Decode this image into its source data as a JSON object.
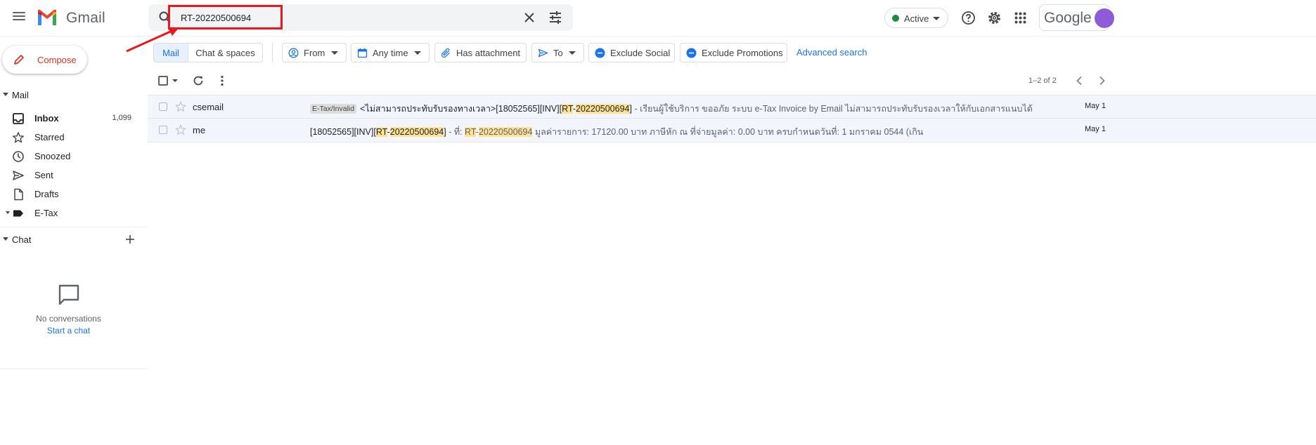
{
  "app": {
    "name": "Gmail"
  },
  "search": {
    "query": "RT-20220500694"
  },
  "status": {
    "label": "Active"
  },
  "account": {
    "brand": "Google"
  },
  "compose": {
    "label": "Compose"
  },
  "nav": {
    "mail_section": "Mail",
    "items": [
      {
        "label": "Inbox",
        "count": "1,099"
      },
      {
        "label": "Starred"
      },
      {
        "label": "Snoozed"
      },
      {
        "label": "Sent"
      },
      {
        "label": "Drafts"
      },
      {
        "label": "E-Tax"
      }
    ],
    "chat_section": "Chat",
    "chat_empty": "No conversations",
    "chat_start": "Start a chat"
  },
  "filters": {
    "segments": [
      "Mail",
      "Chat & spaces"
    ],
    "chips": [
      "From",
      "Any time",
      "Has attachment",
      "To",
      "Exclude Social",
      "Exclude Promotions"
    ],
    "advanced": "Advanced search"
  },
  "pager": {
    "text": "1–2 of 2"
  },
  "messages": [
    {
      "sender": "csemail",
      "label": "E-Tax/Invalid",
      "subject_parts": [
        "<ไม่สามารถประทับรับรองทางเวลา>[18052565][INV][",
        "RT",
        "-",
        "20220500694",
        "]"
      ],
      "snippet": " - เรียนผู้ใช้บริการ ขออภัย ระบบ e-Tax Invoice by Email ไม่สามารถประทับรับรองเวลาให้กับเอกสารแนบได้",
      "date": "May 1"
    },
    {
      "sender": "me",
      "subject_parts": [
        "[18052565][INV][",
        "RT",
        "-",
        "20220500694",
        "]"
      ],
      "snippet_parts": [
        " - ที่: ",
        "RT",
        "-",
        "20220500694",
        " มูลค่ารายการ: 17120.00 บาท ภาษีหัก ณ ที่จ่ายมูลค่า: 0.00 บาท ครบกำหนดวันที่: 1 มกราคม 0544 (เกิน"
      ],
      "date": "May 1"
    }
  ],
  "colors": {
    "accent": "#1a73e8",
    "compose_text": "#d93025",
    "highlight": "#fde293",
    "annotation": "#e8191e",
    "active_dot": "#1e8e3e"
  },
  "icons": [
    "menu-icon",
    "gmail-logo",
    "search-icon",
    "close-icon",
    "tune-icon",
    "help-icon",
    "settings-icon",
    "apps-icon",
    "pencil-icon",
    "inbox-icon",
    "star-icon",
    "clock-icon",
    "send-icon",
    "file-icon",
    "label-icon",
    "plus-icon",
    "chat-bubble-icon",
    "refresh-icon",
    "more-vert-icon",
    "chevron-left-icon",
    "chevron-right-icon"
  ]
}
